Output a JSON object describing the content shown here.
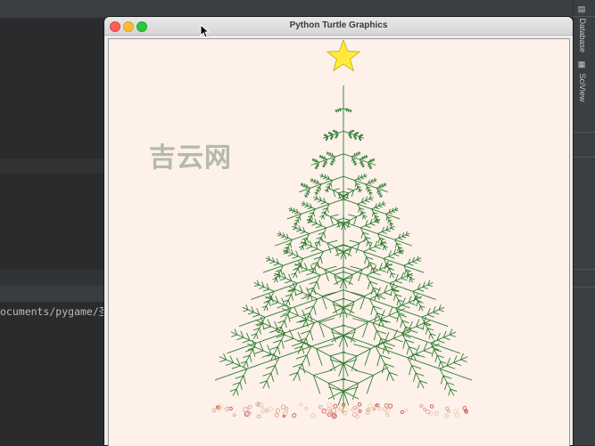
{
  "ide": {
    "terminal_path": "ocuments/pygame/圣",
    "side_tabs": [
      {
        "label": "Database",
        "icon": "database-icon"
      },
      {
        "label": "SciView",
        "icon": "sciview-icon"
      }
    ]
  },
  "window": {
    "title": "Python Turtle Graphics",
    "buttons": [
      "close",
      "minimize",
      "maximize"
    ]
  },
  "canvas": {
    "background": "#fdf1ea",
    "watermark": "吉云网",
    "tree_color": "#2e7d32",
    "star_color": "#ffeb3b",
    "ornament_colors": [
      "#e0a0a0",
      "#d45050",
      "#e8d8a0",
      "#e8c0b0"
    ]
  }
}
